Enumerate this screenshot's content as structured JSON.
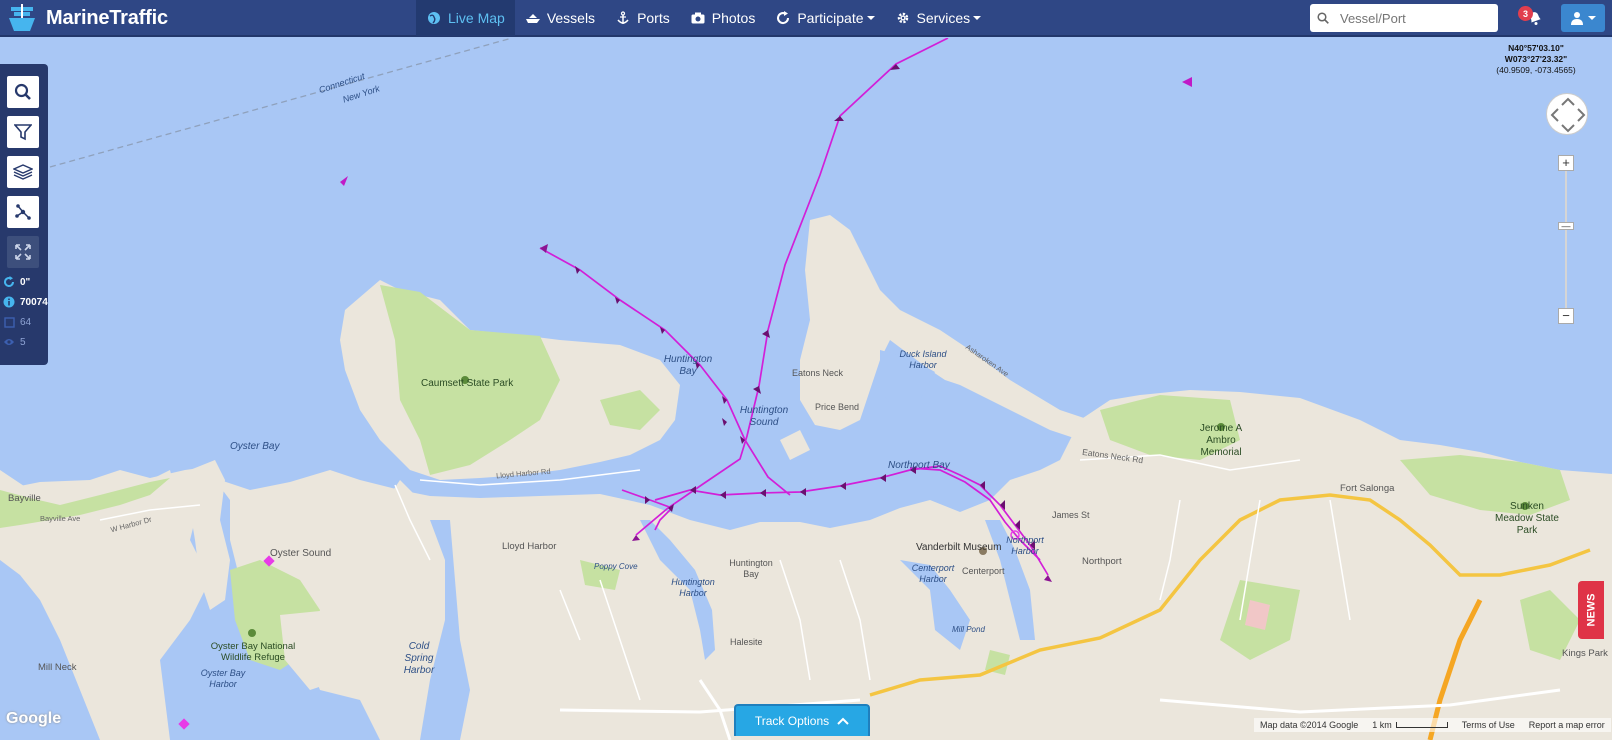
{
  "header": {
    "brand": "MarineTraffic",
    "nav": [
      {
        "label": "Live Map",
        "icon": "globe-icon"
      },
      {
        "label": "Vessels",
        "icon": "ship-icon"
      },
      {
        "label": "Ports",
        "icon": "anchor-icon"
      },
      {
        "label": "Photos",
        "icon": "camera-icon"
      },
      {
        "label": "Participate",
        "icon": "refresh-icon"
      },
      {
        "label": "Services",
        "icon": "gear-icon"
      }
    ],
    "search_placeholder": "Vessel/Port",
    "notification_count": "3"
  },
  "sidebar": {
    "stats": [
      {
        "label": "0\"",
        "icon": "refresh-icon"
      },
      {
        "label": "70074",
        "icon": "info-icon"
      },
      {
        "label": "64",
        "icon": "square-icon"
      },
      {
        "label": "5",
        "icon": "eye-icon"
      }
    ]
  },
  "map": {
    "coords": {
      "lat": "N40°57'03.10\"",
      "lon": "W073°27'23.32\"",
      "decimal": "(40.9509, -073.4565)"
    },
    "labels": {
      "huntington_bay": "Huntington Bay",
      "huntington_sound": "Huntington Sound",
      "northport_bay": "Northport Bay",
      "oyster_bay": "Oyster Bay",
      "oyster_sound": "Oyster Sound",
      "cold_spring_harbor": "Cold Spring Harbor",
      "lloyd_harbor": "Lloyd Harbor",
      "caumsett": "Caumsett State Park",
      "eatons_neck": "Eatons Neck",
      "price_bend": "Price Bend",
      "duck_island": "Duck Island Harbor",
      "asharoken": "Asharoken Ave",
      "vanderbilt": "Vanderbilt Museum",
      "northport": "Northport",
      "northport_harbor": "Northport Harbor",
      "centerport": "Centerport",
      "centerport_harbor": "Centerport Harbor",
      "james_st": "James St",
      "fort_salonga": "Fort Salonga",
      "jerome": "Jerome A Ambro Memorial",
      "sunken_meadow": "Sunken Meadow State Park",
      "kings_park": "Kings Park",
      "oyster_bay_refuge": "Oyster Bay National Wildlife Refuge",
      "oyster_bay_harbor": "Oyster Bay Harbor",
      "mill_neck": "Mill Neck",
      "bayville": "Bayville",
      "bayville_ave": "Bayville Ave",
      "w_harbor_dr": "W Harbor Dr",
      "lloyd_harbor_rd": "Lloyd Harbor Rd",
      "halesite": "Halesite",
      "huntington_bay_town": "Huntington Bay",
      "huntington_harbor": "Huntington Harbor",
      "poppy_cove": "Poppy Cove",
      "connecticut": "Connecticut",
      "new_york": "New York",
      "mill_pond": "Mill Pond",
      "eatons_neck_rd": "Eatons Neck Rd"
    }
  },
  "controls": {
    "zoom_in": "+",
    "zoom_out": "−",
    "news": "NEWS",
    "track_options": "Track Options"
  },
  "attribution": {
    "map_data": "Map data ©2014 Google",
    "scale": "1 km",
    "terms": "Terms of Use",
    "report": "Report a map error",
    "google": "Google"
  }
}
